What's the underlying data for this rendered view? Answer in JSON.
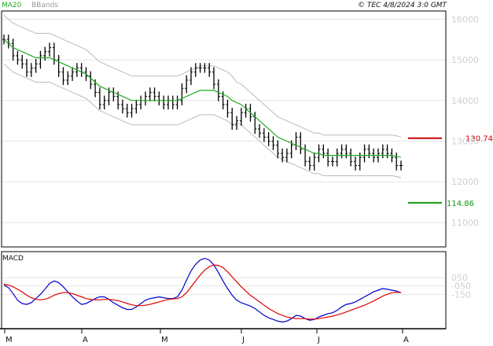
{
  "header": {
    "ma_label": "MA20",
    "bb_label": "BBands",
    "source": "© TEC 4/8/2024 3:0 GMT"
  },
  "colors": {
    "ma": "#22aa22",
    "bbands": "#bbbbbb",
    "bars": "#000000",
    "grid": "#e4e4e4",
    "resistance": "#cc0000",
    "support": "#119911",
    "macd": "#0000cc",
    "signal": "#dd0000"
  },
  "chart_data": [
    {
      "type": "ohlc",
      "y_ticks": [
        110,
        120,
        130,
        140,
        150,
        160
      ],
      "y_tick_labels": [
        "11000",
        "12000",
        "13000",
        "14000",
        "15000",
        "16000"
      ],
      "ylim": [
        104,
        162
      ],
      "x_labels": [
        "M",
        "A",
        "M",
        "J",
        "J",
        "A"
      ],
      "resistance": {
        "value": 130.74,
        "label": "130.74"
      },
      "support": {
        "value": 114.86,
        "label": "114.86"
      },
      "close": [
        155,
        154,
        151,
        150,
        149,
        147,
        148,
        149,
        151,
        152,
        153,
        150,
        147,
        145,
        146,
        147,
        148,
        147,
        146,
        144,
        142,
        139,
        140,
        142,
        141,
        139,
        138,
        137,
        138,
        139,
        140,
        141,
        142,
        141,
        140,
        139,
        140,
        139,
        140,
        143,
        145,
        147,
        148,
        148,
        148,
        147,
        144,
        141,
        139,
        137,
        134,
        135,
        137,
        138,
        136,
        133,
        132,
        131,
        130,
        129,
        127,
        126,
        127,
        129,
        131,
        128,
        125,
        124,
        126,
        128,
        127,
        125,
        125,
        127,
        128,
        127,
        125,
        124,
        126,
        128,
        127,
        126,
        127,
        128,
        127,
        126,
        124,
        124
      ],
      "ma20": [
        155,
        154,
        153,
        152.5,
        152,
        151.5,
        151,
        150.5,
        150.5,
        150.5,
        150.5,
        150,
        149.5,
        149,
        148.5,
        148,
        147.5,
        147,
        146.5,
        145.5,
        144.5,
        143.5,
        143,
        142.5,
        142,
        141.5,
        141,
        140.5,
        140,
        140,
        140,
        140,
        140,
        140,
        140,
        140,
        140,
        140,
        140,
        140.5,
        141,
        141.5,
        142,
        142.5,
        142.5,
        142.5,
        142.5,
        142,
        141.5,
        141,
        140,
        139.5,
        139,
        138,
        137,
        136,
        135,
        134,
        133,
        132,
        131,
        130.5,
        130,
        129.5,
        129,
        128.5,
        128,
        127.5,
        127,
        127,
        126.5,
        126.5,
        126.5,
        126.5,
        126.5,
        126.5,
        126.5,
        126.5,
        126.5,
        126.5,
        126.5,
        126.5,
        126.5,
        126.5,
        126.5,
        126.5,
        126.3,
        126
      ],
      "macd": [
        -40,
        -70,
        -140,
        -220,
        -260,
        -270,
        -250,
        -200,
        -150,
        -90,
        -20,
        10,
        -10,
        -60,
        -120,
        -180,
        -230,
        -270,
        -260,
        -230,
        -200,
        -180,
        -180,
        -210,
        -250,
        -280,
        -310,
        -330,
        -330,
        -300,
        -260,
        -220,
        -200,
        -190,
        -180,
        -190,
        -200,
        -200,
        -180,
        -100,
        20,
        130,
        210,
        260,
        280,
        260,
        200,
        110,
        10,
        -80,
        -160,
        -220,
        -250,
        -270,
        -290,
        -320,
        -360,
        -400,
        -430,
        -450,
        -470,
        -480,
        -470,
        -440,
        -400,
        -410,
        -440,
        -460,
        -450,
        -420,
        -400,
        -380,
        -370,
        -340,
        -300,
        -270,
        -260,
        -240,
        -210,
        -180,
        -150,
        -120,
        -100,
        -80,
        -90,
        -100,
        -110,
        -130
      ],
      "signal": [
        -30,
        -40,
        -60,
        -90,
        -120,
        -160,
        -190,
        -210,
        -215,
        -210,
        -190,
        -160,
        -140,
        -130,
        -130,
        -140,
        -160,
        -180,
        -200,
        -210,
        -215,
        -215,
        -210,
        -210,
        -215,
        -225,
        -240,
        -260,
        -275,
        -285,
        -285,
        -280,
        -270,
        -255,
        -240,
        -225,
        -210,
        -205,
        -200,
        -180,
        -130,
        -60,
        10,
        80,
        140,
        180,
        200,
        195,
        170,
        120,
        60,
        0,
        -60,
        -110,
        -160,
        -200,
        -240,
        -280,
        -320,
        -350,
        -380,
        -400,
        -420,
        -430,
        -440,
        -440,
        -440,
        -445,
        -445,
        -440,
        -430,
        -420,
        -410,
        -395,
        -380,
        -360,
        -340,
        -320,
        -300,
        -280,
        -255,
        -230,
        -200,
        -170,
        -150,
        -130,
        -125,
        -130
      ]
    },
    {
      "type": "line",
      "title": "MACD",
      "y_ticks": [
        50,
        -50,
        -150
      ],
      "y_tick_labels": [
        "050",
        "-050",
        "-150"
      ],
      "ylim": [
        -560,
        360
      ]
    }
  ]
}
